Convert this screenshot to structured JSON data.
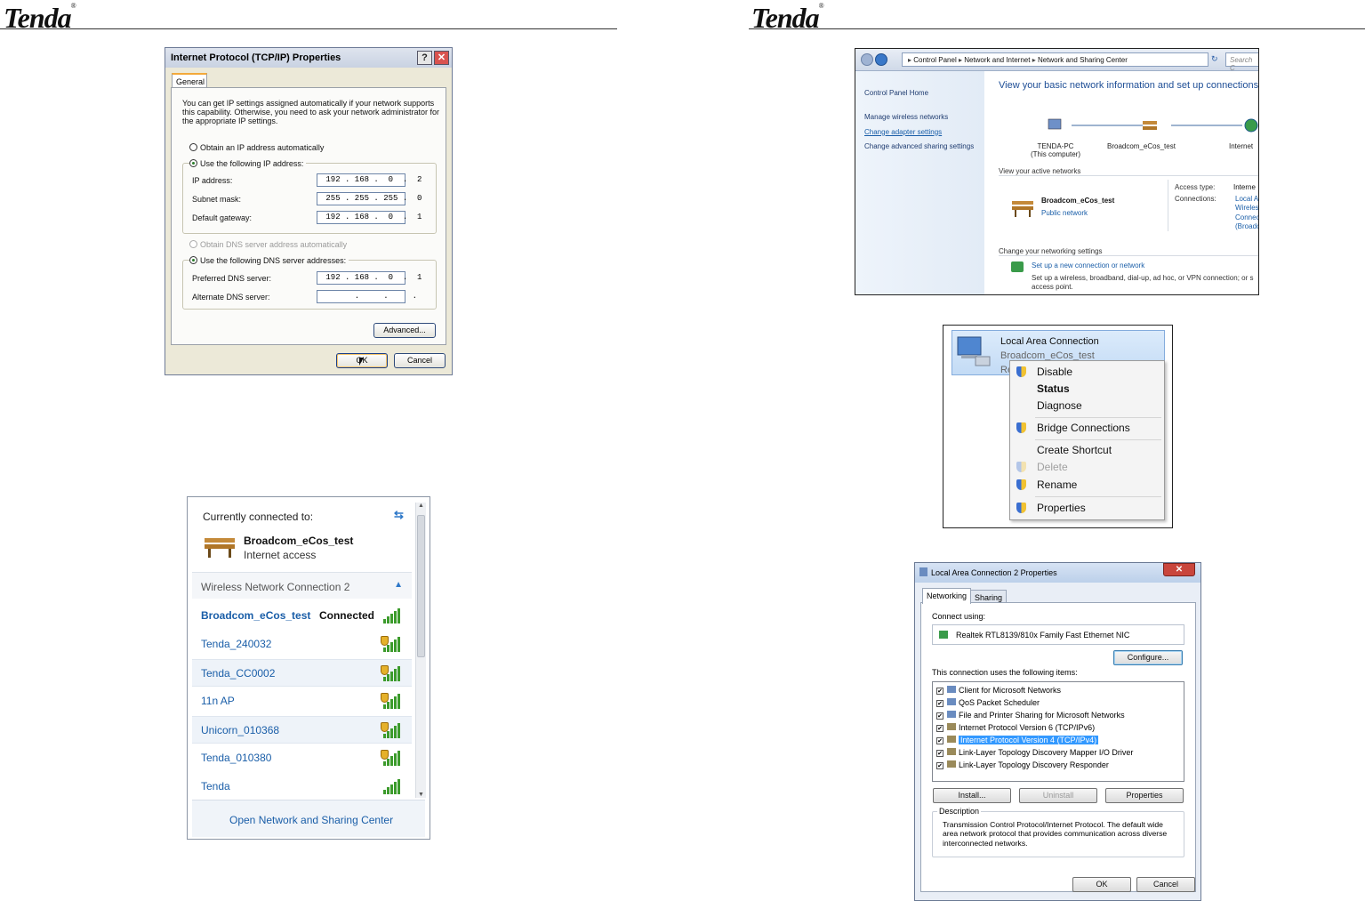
{
  "header": {
    "logo": "Tenda",
    "logo_mark": "®"
  },
  "tcpip": {
    "title": "Internet Protocol (TCP/IP) Properties",
    "help": "?",
    "close": "✕",
    "tab": "General",
    "intro": "You can get IP settings assigned automatically if your network supports this capability. Otherwise, you need to ask your network administrator for the appropriate IP settings.",
    "auto_ip": "Obtain an IP address automatically",
    "use_ip": "Use the following IP address:",
    "ip_label": "IP address:",
    "ip_value": " 192 . 168 .  0  .  2",
    "mask_label": "Subnet mask:",
    "mask_value": " 255 . 255 . 255 .  0",
    "gw_label": "Default gateway:",
    "gw_value": " 192 . 168 .  0  .  1",
    "auto_dns": "Obtain DNS server address automatically",
    "use_dns": "Use the following DNS server addresses:",
    "pref_label": "Preferred DNS server:",
    "pref_value": " 192 . 168 .  0  .  1",
    "alt_label": "Alternate DNS server:",
    "alt_value": "       .     .     .",
    "advanced": "Advanced...",
    "ok": "OK",
    "cancel": "Cancel"
  },
  "wireless": {
    "heading": "Currently connected to:",
    "conn_name": "Broadcom_eCos_test",
    "conn_status": "Internet access",
    "section": "Wireless Network Connection 2",
    "networks": [
      {
        "name": "Broadcom_eCos_test",
        "status": "Connected"
      },
      {
        "name": "Tenda_240032"
      },
      {
        "name": "Tenda_CC0002"
      },
      {
        "name": "11n AP"
      },
      {
        "name": "Unicorn_010368"
      },
      {
        "name": "Tenda_010380"
      },
      {
        "name": "Tenda"
      }
    ],
    "footer": "Open Network and Sharing Center"
  },
  "control_panel": {
    "crumb1": "Control Panel",
    "crumb2": "Network and Internet",
    "crumb3": "Network and Sharing Center",
    "search": "Search C",
    "side": [
      "Control Panel Home",
      "Manage wireless networks",
      "Change adapter settings",
      "Change advanced sharing settings"
    ],
    "heading": "View your basic network information and set up connections",
    "node1": "TENDA-PC",
    "node1_sub": "(This computer)",
    "node2": "Broadcom_eCos_test",
    "node3": "Internet",
    "active": "View your active networks",
    "net_name": "Broadcom_eCos_test",
    "net_type": "Public network",
    "access_label": "Access type:",
    "access_value": "Interne",
    "conn_label": "Connections:",
    "conn_value1": "Local A",
    "conn_value2": "Wireles",
    "conn_value3": "Connec",
    "conn_value4": "(Broadc",
    "change": "Change your networking settings",
    "setup_link": "Set up a new connection or network",
    "setup_desc": "Set up a wireless, broadband, dial-up, ad hoc, or VPN connection; or s access point."
  },
  "context": {
    "adapter_name": "Local Area Connection",
    "adapter_sub": "Broadcom_eCos_test",
    "adapter_sub2": "Re",
    "items": [
      "Disable",
      "Status",
      "Diagnose",
      "Bridge Connections",
      "Create Shortcut",
      "Delete",
      "Rename",
      "Properties"
    ]
  },
  "lan_props": {
    "title": "Local Area Connection 2 Properties",
    "close": "✕",
    "tab1": "Networking",
    "tab2": "Sharing",
    "connect_using": "Connect using:",
    "adapter": "Realtek RTL8139/810x Family Fast Ethernet NIC",
    "configure": "Configure...",
    "uses": "This connection uses the following items:",
    "items": [
      "Client for Microsoft Networks",
      "QoS Packet Scheduler",
      "File and Printer Sharing for Microsoft Networks",
      "Internet Protocol Version 6 (TCP/IPv6)",
      "Internet Protocol Version 4 (TCP/IPv4)",
      "Link-Layer Topology Discovery Mapper I/O Driver",
      "Link-Layer Topology Discovery Responder"
    ],
    "install": "Install...",
    "uninstall": "Uninstall",
    "properties": "Properties",
    "desc_label": "Description",
    "desc_text": "Transmission Control Protocol/Internet Protocol. The default wide area network protocol that provides communication across diverse interconnected networks.",
    "ok": "OK",
    "cancel": "Cancel"
  }
}
